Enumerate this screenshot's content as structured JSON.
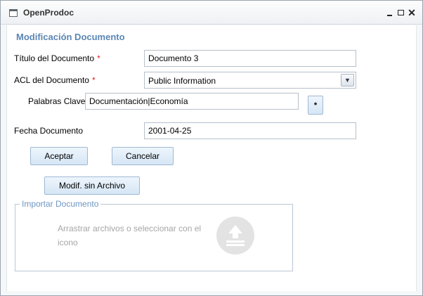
{
  "window": {
    "title": "OpenProdoc",
    "icon": "window-icon",
    "controls": [
      "minimize-icon",
      "maximize-icon",
      "close-icon"
    ]
  },
  "form": {
    "title": "Modificación Documento",
    "fields": {
      "titulo": {
        "label": "Título del Documento",
        "required_mark": "*",
        "value": "Documento 3"
      },
      "acl": {
        "label": "ACL del Documento",
        "required_mark": "*",
        "value": "Public Information"
      },
      "palabras": {
        "label": "Palabras Clave",
        "value": "Documentación|Economía",
        "button_label": "*"
      },
      "fecha": {
        "label": "Fecha Documento",
        "value": "2001-04-25"
      }
    },
    "buttons": {
      "accept": "Aceptar",
      "cancel": "Cancelar",
      "modify_no_file": "Modif. sin Archivo"
    }
  },
  "import": {
    "legend": "Importar Documento",
    "hint": "Arrastrar archivos o seleccionar con el icono",
    "icon": "upload-icon"
  },
  "colors": {
    "accent": "#5b86b5",
    "required": "#e02020",
    "button_bg": "#d6e6f5",
    "hint_text": "#a6a6a6"
  }
}
